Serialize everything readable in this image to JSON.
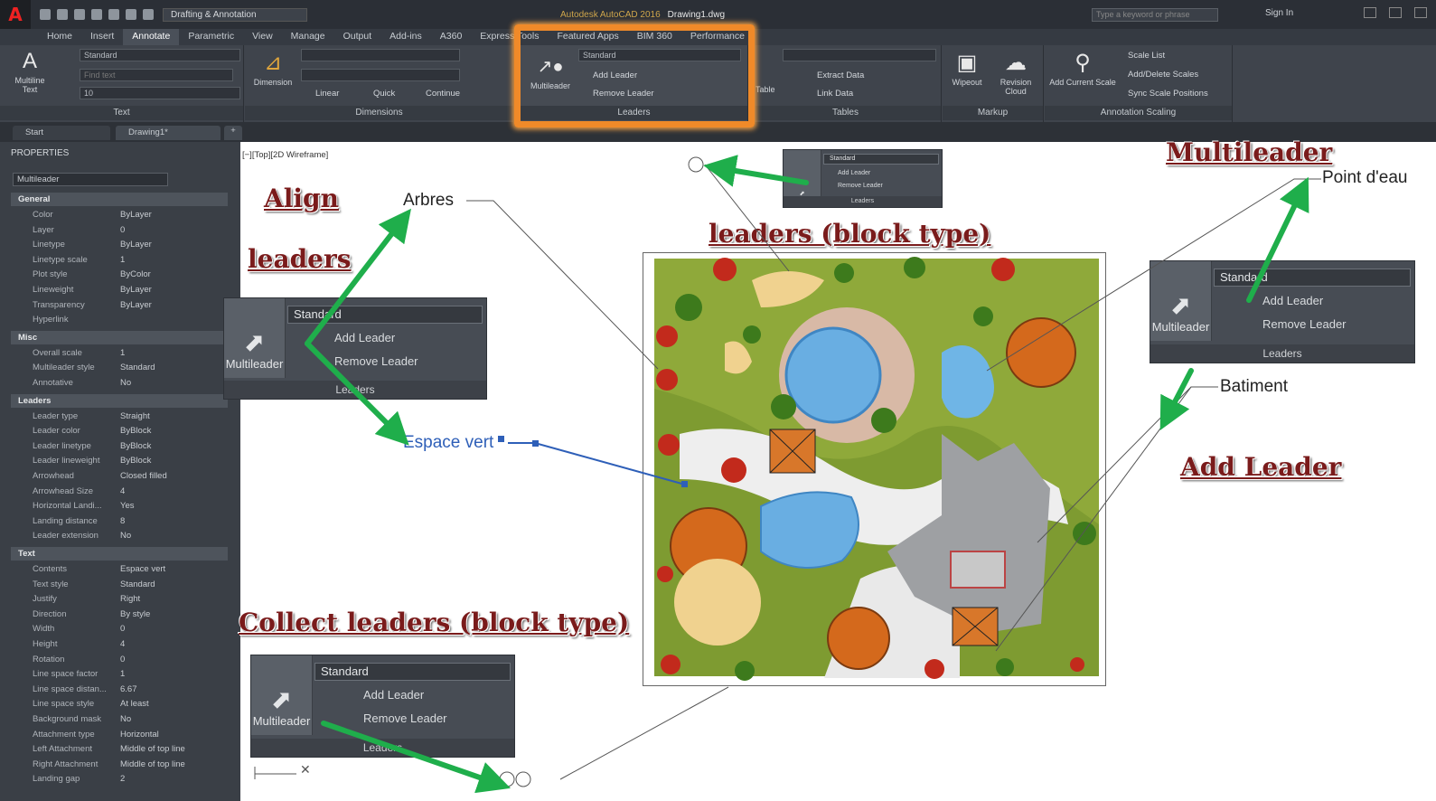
{
  "titlebar": {
    "workspace": "Drafting & Annotation",
    "app_title": "Autodesk AutoCAD 2016",
    "document": "Drawing1.dwg",
    "search_placeholder": "Type a keyword or phrase",
    "signin": "Sign In"
  },
  "ribbon_tabs": [
    "Home",
    "Insert",
    "Annotate",
    "Parametric",
    "View",
    "Manage",
    "Output",
    "Add-ins",
    "A360",
    "Express Tools",
    "Featured Apps",
    "BIM 360",
    "Performance"
  ],
  "ribbon_active_tab": "Annotate",
  "ribbon": {
    "text_panel": {
      "big_button": "Multiline Text",
      "style": "Standard",
      "find": "Find text",
      "height": "10",
      "label": "Text"
    },
    "dimensions_panel": {
      "big_button": "Dimension",
      "linear": "Linear",
      "quick": "Quick",
      "continue": "Continue",
      "label": "Dimensions"
    },
    "leaders_panel": {
      "big_button": "Multileader",
      "style": "Standard",
      "add": "Add Leader",
      "remove": "Remove Leader",
      "label": "Leaders"
    },
    "tables_panel": {
      "big_button": "Table",
      "extract": "Extract Data",
      "link": "Link Data",
      "label": "Tables"
    },
    "markup_panel": {
      "wipeout": "Wipeout",
      "revision": "Revision Cloud",
      "label": "Markup"
    },
    "scaling_panel": {
      "add_scale": "Add Current Scale",
      "scale_list": "Scale List",
      "add_delete": "Add/Delete Scales",
      "sync": "Sync Scale Positions",
      "label": "Annotation Scaling"
    }
  },
  "doc_tabs": [
    "Start",
    "Drawing1*"
  ],
  "viewport_label": "[−][Top][2D Wireframe]",
  "properties": {
    "title": "PROPERTIES",
    "selection": "Multileader",
    "sections": [
      {
        "name": "General",
        "rows": [
          [
            "Color",
            "ByLayer"
          ],
          [
            "Layer",
            "0"
          ],
          [
            "Linetype",
            "ByLayer"
          ],
          [
            "Linetype scale",
            "1"
          ],
          [
            "Plot style",
            "ByColor"
          ],
          [
            "Lineweight",
            "ByLayer"
          ],
          [
            "Transparency",
            "ByLayer"
          ],
          [
            "Hyperlink",
            ""
          ]
        ]
      },
      {
        "name": "Misc",
        "rows": [
          [
            "Overall scale",
            "1"
          ],
          [
            "Multileader style",
            "Standard"
          ],
          [
            "Annotative",
            "No"
          ]
        ]
      },
      {
        "name": "Leaders",
        "rows": [
          [
            "Leader type",
            "Straight"
          ],
          [
            "Leader color",
            "ByBlock"
          ],
          [
            "Leader linetype",
            "ByBlock"
          ],
          [
            "Leader lineweight",
            "ByBlock"
          ],
          [
            "Arrowhead",
            "Closed filled"
          ],
          [
            "Arrowhead Size",
            "4"
          ],
          [
            "Horizontal Landi...",
            "Yes"
          ],
          [
            "Landing distance",
            "8"
          ],
          [
            "Leader extension",
            "No"
          ]
        ]
      },
      {
        "name": "Text",
        "rows": [
          [
            "Contents",
            "Espace vert"
          ],
          [
            "Text style",
            "Standard"
          ],
          [
            "Justify",
            "Right"
          ],
          [
            "Direction",
            "By style"
          ],
          [
            "Width",
            "0"
          ],
          [
            "Height",
            "4"
          ],
          [
            "Rotation",
            "0"
          ],
          [
            "Line space factor",
            "1"
          ],
          [
            "Line space distan...",
            "6.67"
          ],
          [
            "Line space style",
            "At least"
          ],
          [
            "Background mask",
            "No"
          ],
          [
            "Attachment type",
            "Horizontal"
          ],
          [
            "Left Attachment",
            "Middle of top line"
          ],
          [
            "Right Attachment",
            "Middle of top line"
          ],
          [
            "Landing gap",
            "2"
          ]
        ]
      }
    ]
  },
  "callouts": {
    "align": "Align",
    "leaders": "leaders",
    "block_type": "leaders (block type)",
    "multileader": "Multileader",
    "add_leader": "Add Leader",
    "collect": "Collect leaders (block type)"
  },
  "annotations": {
    "arbres": "Arbres",
    "point_eau": "Point d'eau",
    "batiment": "Batiment",
    "espace_vert": "Espace vert"
  },
  "popup": {
    "big": "Multileader",
    "style": "Standard",
    "add": "Add Leader",
    "remove": "Remove Leader",
    "foot": "Leaders"
  },
  "colors": {
    "arrow": "#1fae4b",
    "highlight": "#f08a29",
    "callout_text": "#7a1b1b"
  }
}
